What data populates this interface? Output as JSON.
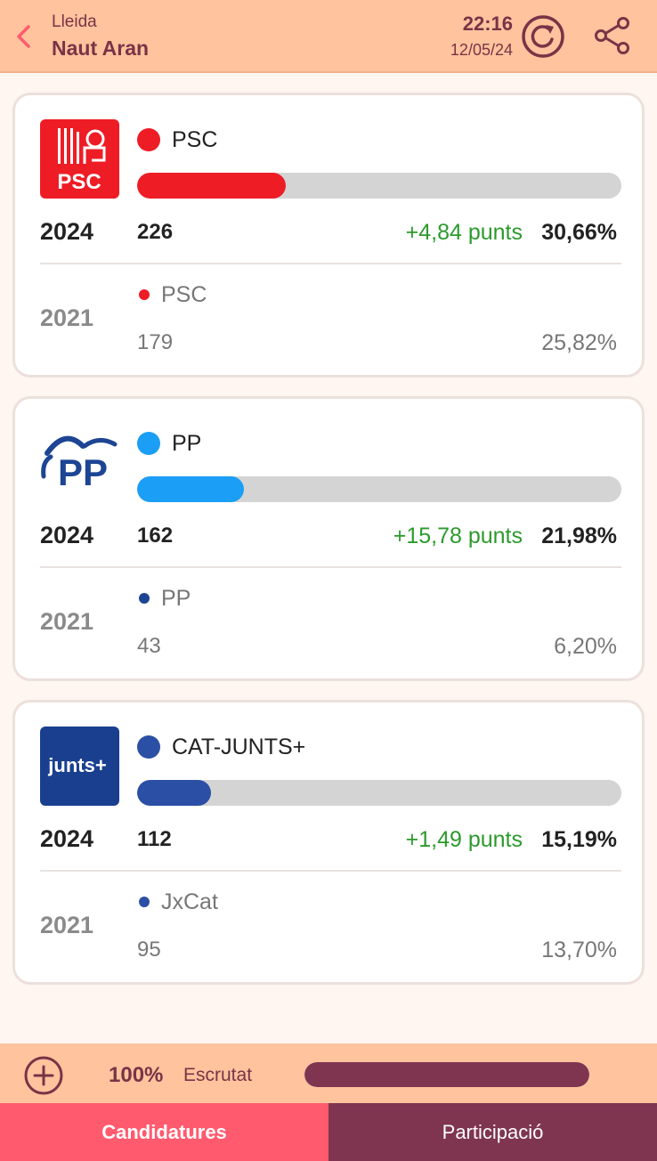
{
  "header": {
    "region": "Lleida",
    "place": "Naut Aran",
    "time": "22:16",
    "date": "12/05/24",
    "icons": [
      "back-chevron-icon",
      "refresh-icon",
      "share-icon"
    ]
  },
  "results": [
    {
      "party": "PSC",
      "color": "#ee1c25",
      "logo_text": "PSC",
      "year_now": "2024",
      "seats_now": "226",
      "delta": "+4,84 punts",
      "pct_now": "30,66%",
      "bar_fraction": 0.3066,
      "year_prev": "2021",
      "party_prev": "PSC",
      "color_prev": "#ee1c25",
      "seats_prev": "179",
      "pct_prev": "25,82%"
    },
    {
      "party": "PP",
      "color": "#1b9ef5",
      "logo_text": "PP",
      "year_now": "2024",
      "seats_now": "162",
      "delta": "+15,78 punts",
      "pct_now": "21,98%",
      "bar_fraction": 0.2198,
      "year_prev": "2021",
      "party_prev": "PP",
      "color_prev": "#1d4594",
      "seats_prev": "43",
      "pct_prev": "6,20%"
    },
    {
      "party": "CAT-JUNTS+",
      "color": "#2b4fa5",
      "logo_text": "junts+",
      "year_now": "2024",
      "seats_now": "112",
      "delta": "+1,49 punts",
      "pct_now": "15,19%",
      "bar_fraction": 0.1519,
      "year_prev": "2021",
      "party_prev": "JxCat",
      "color_prev": "#2b4fa5",
      "seats_prev": "95",
      "pct_prev": "13,70%"
    }
  ],
  "footer": {
    "scrutiny_pct": "100%",
    "scrutiny_label": "Escrutat",
    "scrutiny_fraction": 1.0
  },
  "tabs": {
    "candidatures": "Candidatures",
    "participacio": "Participació"
  }
}
